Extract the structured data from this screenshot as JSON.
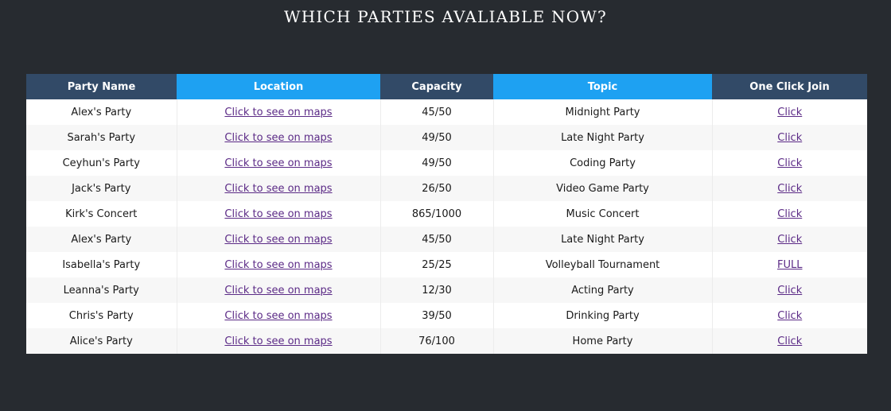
{
  "page": {
    "title": "WHICH PARTIES AVALIABLE NOW?"
  },
  "table": {
    "headers": {
      "party_name": "Party Name",
      "location": "Location",
      "capacity": "Capacity",
      "topic": "Topic",
      "join": "One Click Join"
    },
    "header_colors": {
      "dark": "#324a67",
      "accent": "#1ea1f2"
    },
    "rows": [
      {
        "name": "Alex's Party",
        "location": "Click to see on maps",
        "capacity": "45/50",
        "topic": "Midnight Party",
        "join": "Click"
      },
      {
        "name": "Sarah's Party",
        "location": "Click to see on maps",
        "capacity": "49/50",
        "topic": "Late Night Party",
        "join": "Click"
      },
      {
        "name": "Ceyhun's Party",
        "location": "Click to see on maps",
        "capacity": "49/50",
        "topic": "Coding Party",
        "join": "Click"
      },
      {
        "name": "Jack's Party",
        "location": "Click to see on maps",
        "capacity": "26/50",
        "topic": "Video Game Party",
        "join": "Click"
      },
      {
        "name": "Kirk's Concert",
        "location": "Click to see on maps",
        "capacity": "865/1000",
        "topic": "Music Concert",
        "join": "Click"
      },
      {
        "name": "Alex's Party",
        "location": "Click to see on maps",
        "capacity": "45/50",
        "topic": "Late Night Party",
        "join": "Click"
      },
      {
        "name": "Isabella's Party",
        "location": "Click to see on maps",
        "capacity": "25/25",
        "topic": "Volleyball Tournament",
        "join": "FULL"
      },
      {
        "name": "Leanna's Party",
        "location": "Click to see on maps",
        "capacity": "12/30",
        "topic": "Acting Party",
        "join": "Click"
      },
      {
        "name": "Chris's Party",
        "location": "Click to see on maps",
        "capacity": "39/50",
        "topic": "Drinking Party",
        "join": "Click"
      },
      {
        "name": "Alice's Party",
        "location": "Click to see on maps",
        "capacity": "76/100",
        "topic": "Home Party",
        "join": "Click"
      }
    ]
  }
}
